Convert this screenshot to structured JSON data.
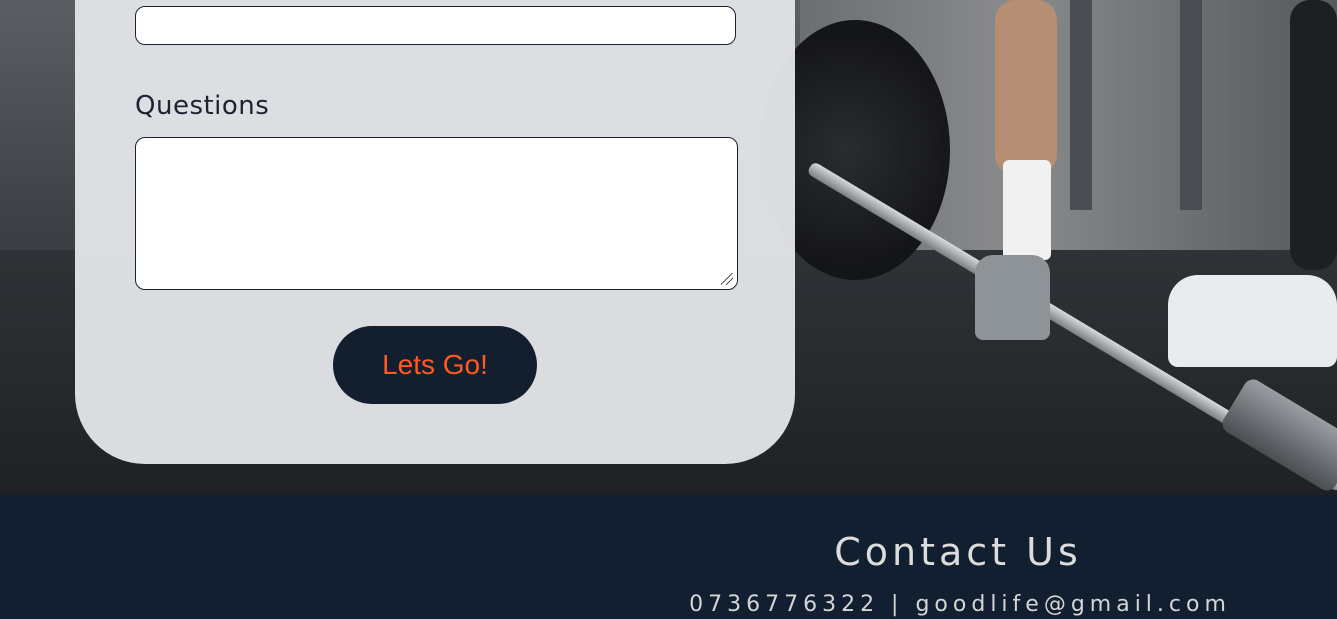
{
  "form": {
    "name_field_value": "",
    "questions_label": "Questions",
    "questions_value": "",
    "submit_label": "Lets Go!"
  },
  "footer": {
    "title": "Contact Us",
    "contact_line": "0736776322 | goodlife@gmail.com"
  },
  "colors": {
    "navy": "#121f30",
    "button_text": "#ff5a1f",
    "card": "#e2e4e7"
  },
  "icons": {
    "textarea_resize": "resize-grip-icon"
  }
}
